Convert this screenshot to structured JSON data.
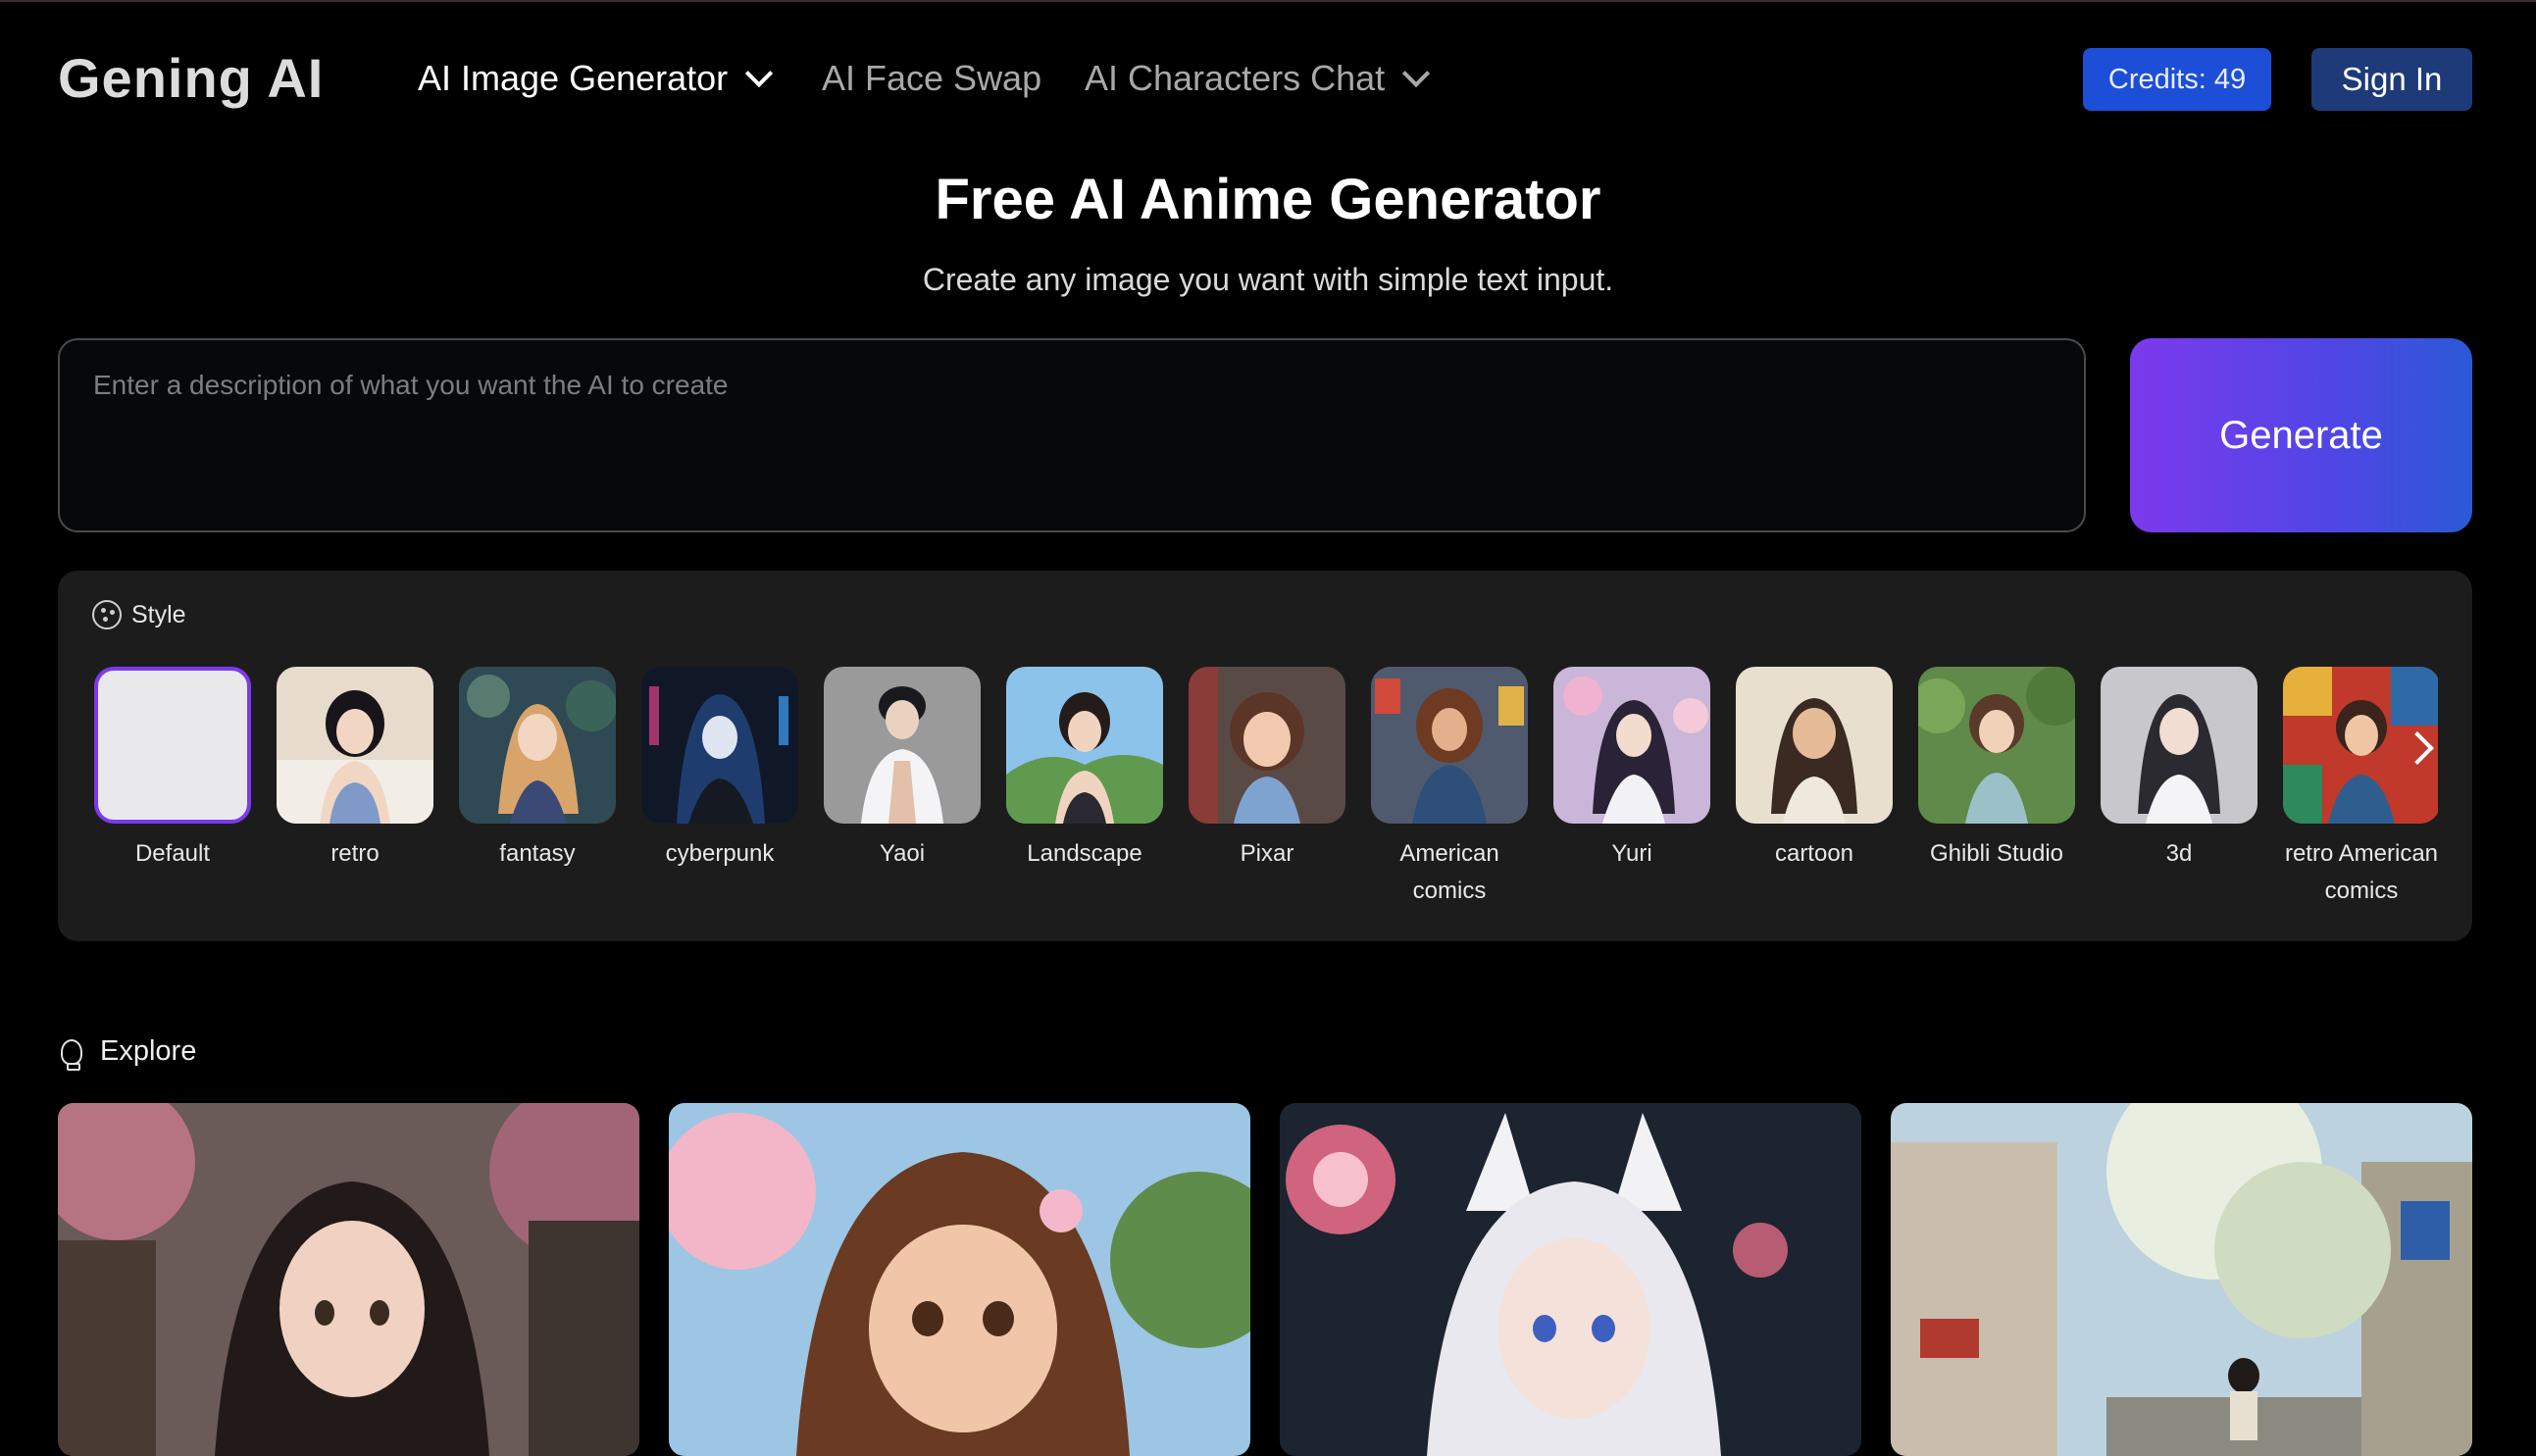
{
  "header": {
    "logo": "Gening AI",
    "nav": [
      {
        "label": "AI Image Generator"
      },
      {
        "label": "AI Face Swap"
      },
      {
        "label": "AI Characters Chat"
      }
    ],
    "credits_label": "Credits: 49",
    "signin_label": "Sign In"
  },
  "hero": {
    "title": "Free AI Anime Generator",
    "subtitle": "Create any image you want with simple text input."
  },
  "prompt": {
    "placeholder": "Enter a description of what you want the AI to create",
    "generate_label": "Generate"
  },
  "styles": {
    "heading": "Style",
    "items": [
      {
        "label": "Default"
      },
      {
        "label": "retro"
      },
      {
        "label": "fantasy"
      },
      {
        "label": "cyberpunk"
      },
      {
        "label": "Yaoi"
      },
      {
        "label": "Landscape"
      },
      {
        "label": "Pixar"
      },
      {
        "label": "American comics"
      },
      {
        "label": "Yuri"
      },
      {
        "label": "cartoon"
      },
      {
        "label": "Ghibli Studio"
      },
      {
        "label": "3d"
      },
      {
        "label": "retro American comics"
      }
    ]
  },
  "explore": {
    "heading": "Explore"
  },
  "colors": {
    "accent_purple": "#7c3aed",
    "accent_blue": "#1d4ed8",
    "background": "#000000",
    "panel": "#1c1c1c"
  }
}
